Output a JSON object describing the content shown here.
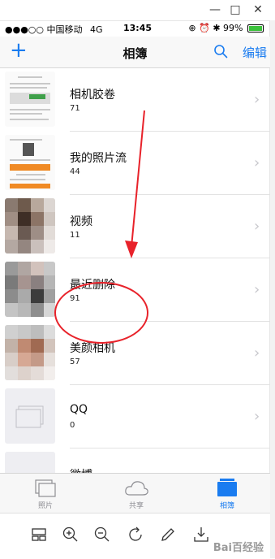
{
  "window": {
    "controls": [
      "—",
      "□",
      "✕"
    ]
  },
  "status_bar": {
    "signal": "●●●○○",
    "carrier": "中国移动",
    "network": "4G",
    "time": "13:45",
    "battery": "99%",
    "battery_level": 0.99
  },
  "nav": {
    "add_label": "+",
    "title": "相簿",
    "edit_label": "编辑"
  },
  "albums": [
    {
      "name": "相机胶卷",
      "count": "71"
    },
    {
      "name": "我的照片流",
      "count": "44"
    },
    {
      "name": "视频",
      "count": "11"
    },
    {
      "name": "最近删除",
      "count": "91"
    },
    {
      "name": "美颜相机",
      "count": "57"
    },
    {
      "name": "QQ",
      "count": "0"
    },
    {
      "name": "微博",
      "count": ""
    }
  ],
  "tabs": [
    {
      "label": "照片",
      "icon": "photos-icon",
      "active": false
    },
    {
      "label": "共享",
      "icon": "cloud-icon",
      "active": false
    },
    {
      "label": "相簿",
      "icon": "albums-icon",
      "active": true
    }
  ],
  "toolbar": {
    "icons": [
      "layout-icon",
      "zoom-in-icon",
      "zoom-out-icon",
      "rotate-icon",
      "edit-icon",
      "download-icon"
    ]
  },
  "watermark": "Bai百经验",
  "colors": {
    "accent": "#1a7cf0",
    "annotation": "#e8222a"
  }
}
